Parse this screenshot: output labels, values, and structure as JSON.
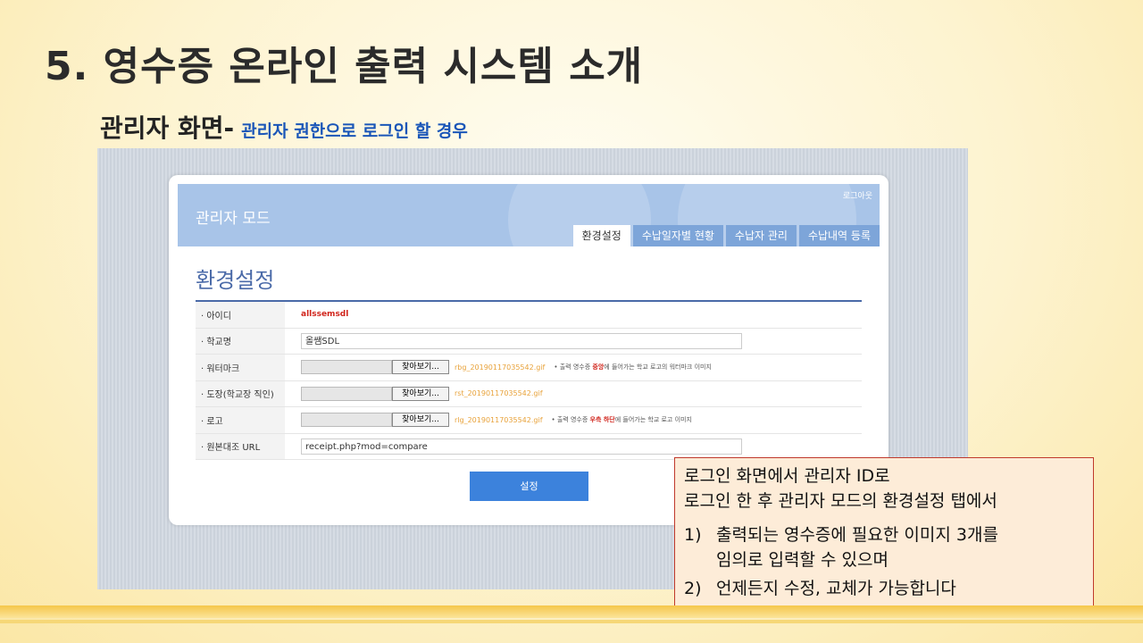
{
  "slide": {
    "title": "5. 영수증 온라인 출력 시스템 소개",
    "subtitle_main": "관리자 화면-",
    "subtitle_sub": "관리자 권한으로 로그인 할 경우"
  },
  "admin": {
    "mode_title": "관리자 모드",
    "logout": "로그아웃",
    "tabs": [
      "환경설정",
      "수납일자별 현황",
      "수납자 관리",
      "수납내역 등록"
    ],
    "page_title": "환경설정",
    "fields": {
      "id_label": "· 아이디",
      "id_value": "allssemsdl",
      "school_label": "· 학교명",
      "school_value": "올쌤SDL",
      "watermark_label": "· 워터마크",
      "watermark_file": "rbg_20190117035542.gif",
      "watermark_note_pre": "• 출력 영수증 ",
      "watermark_note_red": "중앙",
      "watermark_note_post": "에 들어가는 학교 로고의 워터마크 이미지",
      "stamp_label": "· 도장(학교장 직인)",
      "stamp_file": "rst_20190117035542.gif",
      "logo_label": "· 로고",
      "logo_file": "rlg_20190117035542.gif",
      "logo_note_pre": "• 출력 영수증 ",
      "logo_note_red": "우측 하단",
      "logo_note_post": "에 들어가는 학교 로고 이미지",
      "url_label": "· 원본대조 URL",
      "url_value": "receipt.php?mod=compare",
      "browse_label": "찾아보기..."
    },
    "submit_label": "설정"
  },
  "callout": {
    "line1": "로그인 화면에서 관리자 ID로",
    "line2": "로그인 한 후 관리자 모드의 환경설정 탭에서",
    "item1_num": "1)",
    "item1_line1": "출력되는 영수증에 필요한 이미지 3개를",
    "item1_line2": "임의로 입력할 수 있으며",
    "item2_num": "2)",
    "item2_text": "언제든지 수정, 교체가 가능합니다"
  }
}
